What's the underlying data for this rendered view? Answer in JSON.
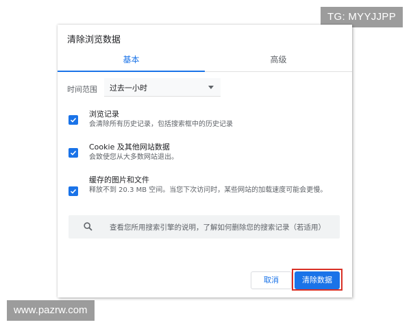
{
  "watermarks": {
    "top_right": "TG: MYYJJPP",
    "bottom_left": "www.pazrw.com"
  },
  "dialog": {
    "title": "清除浏览数据",
    "tabs": [
      {
        "label": "基本",
        "active": true
      },
      {
        "label": "高级",
        "active": false
      }
    ],
    "time_range": {
      "label": "时间范围",
      "selected": "过去一小时"
    },
    "options": [
      {
        "title": "浏览记录",
        "description": "会清除所有历史记录，包括搜索框中的历史记录",
        "checked": true
      },
      {
        "title": "Cookie 及其他网站数据",
        "description": "会致使您从大多数网站退出。",
        "checked": true
      },
      {
        "title": "缓存的图片和文件",
        "description": "释放不到 20.3 MB 空间。当您下次访问时，某些网站的加载速度可能会更慢。",
        "checked": true
      }
    ],
    "search_hint": "查看您所用搜索引擎的说明，了解如何删除您的搜索记录（若适用）",
    "buttons": {
      "cancel": "取消",
      "clear": "清除数据"
    }
  },
  "colors": {
    "accent": "#1a73e8",
    "highlight_border": "#d93025",
    "watermark_bg": "#9c9c9c"
  }
}
